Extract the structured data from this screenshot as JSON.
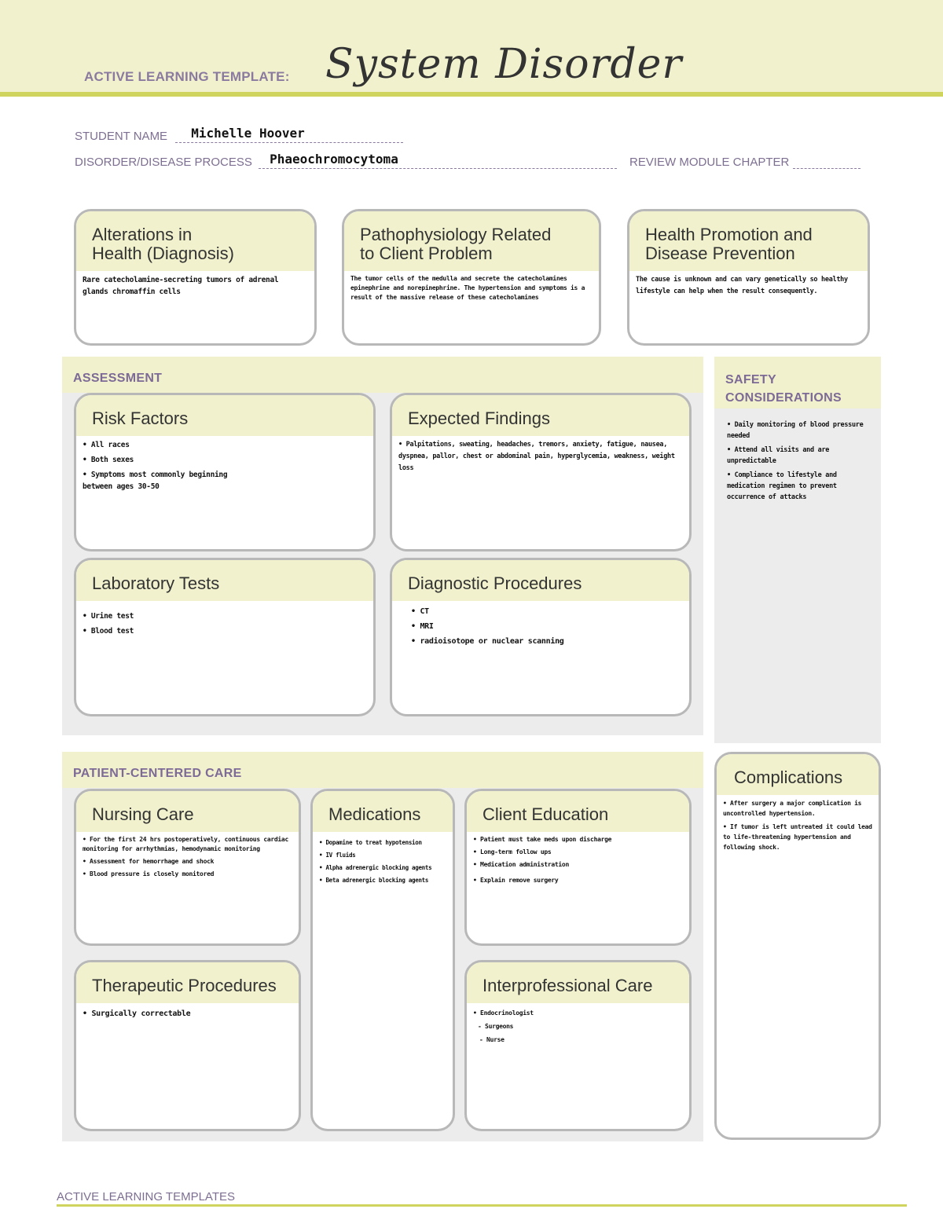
{
  "header": {
    "template_label": "ACTIVE LEARNING TEMPLATE:",
    "title": "System Disorder"
  },
  "fields": {
    "student_name_label": "STUDENT NAME",
    "student_name_value": "Michelle Hoover",
    "disorder_label": "DISORDER/DISEASE PROCESS",
    "disorder_value": "Phaeochromocytoma",
    "review_module_label": "REVIEW MODULE CHAPTER",
    "review_module_value": ""
  },
  "top_boxes": {
    "alterations": {
      "title_line1": "Alterations in",
      "title_line2": "Health (Diagnosis)",
      "text": "Rare catecholamine-secreting tumors of adrenal glands chromaffin cells"
    },
    "pathophysiology": {
      "title_line1": "Pathophysiology Related",
      "title_line2": "to Client Problem",
      "text": "The tumor cells of the medulla and secrete the catecholamines epinephrine and norepinephrine. The hypertension and symptoms is a result of the massive release of these catecholamines"
    },
    "health_promotion": {
      "title_line1": "Health Promotion and",
      "title_line2": "Disease Prevention",
      "text": "The cause is unknown and can vary genetically so healthy lifestyle can help when the result consequently."
    }
  },
  "assessment": {
    "section_label": "ASSESSMENT",
    "risk_factors": {
      "title": "Risk Factors",
      "items": [
        "All races",
        "Both sexes",
        "Symptoms most commonly beginning",
        "between ages 30-50"
      ]
    },
    "expected_findings": {
      "title": "Expected Findings",
      "text": "Palpitations, sweating, headaches, tremors, anxiety, fatigue, nausea, dyspnea, pallor, chest or abdominal pain, hyperglycemia, weakness, weight loss"
    },
    "laboratory_tests": {
      "title": "Laboratory Tests",
      "items": [
        "Urine test",
        "Blood test"
      ]
    },
    "diagnostic_procedures": {
      "title": "Diagnostic Procedures",
      "items": [
        "CT",
        "MRI",
        "radioisotope or nuclear scanning"
      ]
    }
  },
  "safety": {
    "section_label_line1": "SAFETY",
    "section_label_line2": "CONSIDERATIONS",
    "items": [
      "Daily monitoring of blood pressure needed",
      "Attend all visits and are unpredictable",
      "Compliance to lifestyle and medication regimen to prevent occurrence of attacks"
    ]
  },
  "patient_centered_care": {
    "section_label": "PATIENT-CENTERED CARE",
    "nursing_care": {
      "title": "Nursing Care",
      "items": [
        "For the first 24 hrs postoperatively, continuous cardiac monitoring for arrhythmias, hemodynamic monitoring",
        "Assessment for hemorrhage and shock",
        "Blood pressure is closely monitored"
      ]
    },
    "medications": {
      "title": "Medications",
      "items": [
        "Dopamine to treat hypotension",
        "IV fluids",
        "Alpha adrenergic blocking agents",
        "Beta adrenergic blocking agents"
      ]
    },
    "client_education": {
      "title": "Client Education",
      "items": [
        "Patient must take meds upon discharge",
        "Long-term follow ups",
        "Medication administration",
        "Explain remove surgery"
      ]
    },
    "therapeutic_procedures": {
      "title": "Therapeutic Procedures",
      "items": [
        "Surgically correctable"
      ]
    },
    "interprofessional_care": {
      "title": "Interprofessional Care",
      "items": [
        "Endocrinologist",
        "Surgeons",
        "Nurse"
      ]
    }
  },
  "complications": {
    "title": "Complications",
    "items": [
      "After surgery a major complication is uncontrolled hypertension.",
      "If tumor is left untreated it could lead to life-threatening hypertension and following shock."
    ]
  },
  "footer": {
    "label": "ACTIVE LEARNING TEMPLATES"
  }
}
